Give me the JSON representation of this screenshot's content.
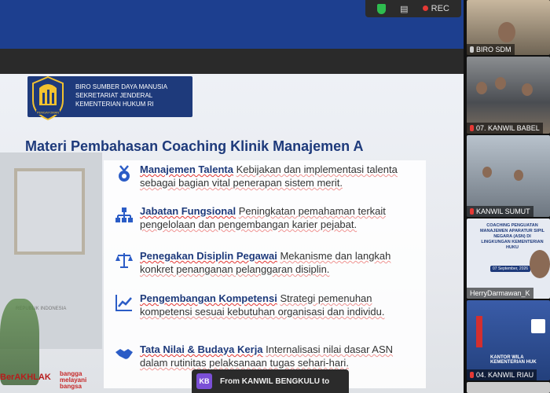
{
  "toolbar": {
    "rec_label": "REC"
  },
  "slide": {
    "header_lines": [
      "BIRO SUMBER DAYA MANUSIA",
      "SEKRETARIAT JENDERAL",
      "KEMENTERIAN HUKUM RI"
    ],
    "emblem_label": "PENGAYOMAN",
    "title": "Materi Pembahasan Coaching Klinik Manajemen A",
    "wall_text": "REPUBLIK INDONESIA",
    "items": [
      {
        "icon": "talent-icon",
        "heading": "Manajemen Talenta",
        "desc": "Kebijakan dan implementasi talenta sebagai bagian vital penerapan sistem merit."
      },
      {
        "icon": "org-chart-icon",
        "heading": "Jabatan Fungsional",
        "desc": "Peningkatan pemahaman terkait pengelolaan dan pengembangan karier pejabat."
      },
      {
        "icon": "scale-icon",
        "heading": "Penegakan Disiplin Pegawai",
        "desc": "Mekanisme dan langkah konkret penanganan pelanggaran disiplin."
      },
      {
        "icon": "growth-chart-icon",
        "heading": "Pengembangan Kompetensi",
        "desc": "Strategi pemenuhan kompetensi sesuai kebutuhan organisasi dan individu."
      },
      {
        "icon": "handshake-icon",
        "heading": "Tata Nilai & Budaya Kerja",
        "desc": "Internalisasi nilai dasar ASN dalam rutinitas pelaksanaan tugas sehari-hari."
      }
    ],
    "footer_left": "BerAKHLAK",
    "footer_right": [
      "bangga",
      "melayani",
      "bangsa"
    ]
  },
  "chat": {
    "avatar": "KB",
    "message": "From KANWIL BENGKULU to"
  },
  "participants": [
    {
      "name": "BIRO SDM",
      "muted": false
    },
    {
      "name": "07. KANWIL BABEL",
      "muted": true
    },
    {
      "name": "KANWIL SUMUT",
      "muted": true
    },
    {
      "name": "HerryDarmawan_K",
      "muted": false
    },
    {
      "name": "04. KANWIL RIAU",
      "muted": true
    }
  ],
  "tile_texts": {
    "coaching": "COACHING PENGUATAN MANAJEMEN APARATUR SIPIL NEGARA (ASN) DI LINGKUNGAN KEMENTERIAN HUKU",
    "date": "07 September, 2026",
    "kantor": "KANTOR WILA KEMENTERIAN HUK"
  },
  "colors": {
    "brand_blue": "#1e3a7b",
    "rec_red": "#e53935",
    "shield_green": "#2ebc4f"
  }
}
